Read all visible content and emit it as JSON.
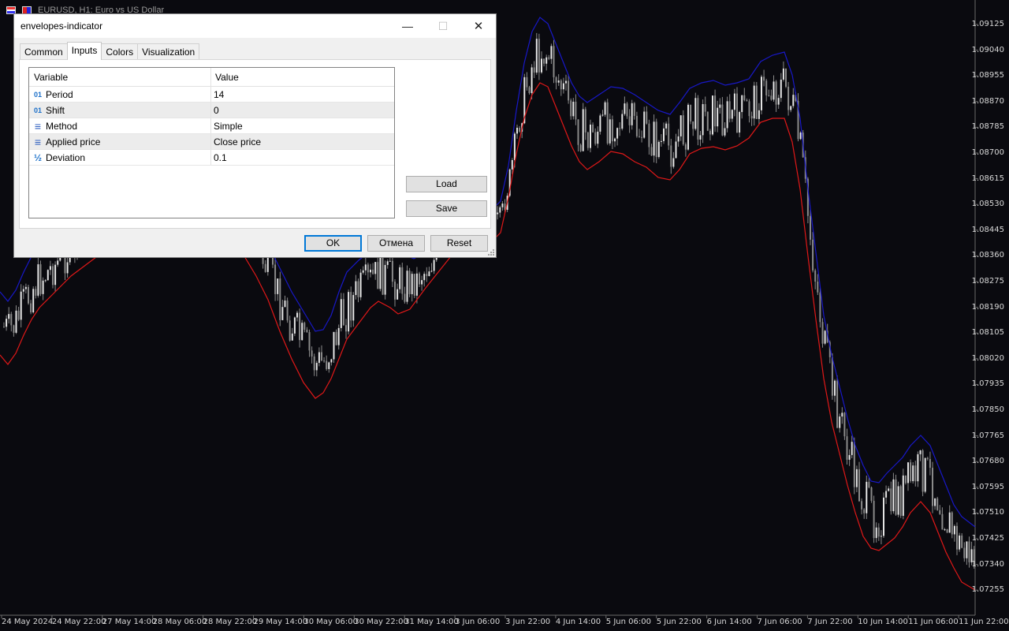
{
  "chart": {
    "title": "EURUSD, H1:  Euro vs US Dollar",
    "bull_color": "#ffffff",
    "upper_color": "#1818c8",
    "lower_color": "#e01818",
    "candle_color": "#8a8a8a",
    "price_labels": [
      "1.09125",
      "1.09040",
      "1.08955",
      "1.08870",
      "1.08785",
      "1.08700",
      "1.08615",
      "1.08530",
      "1.08445",
      "1.08360",
      "1.08275",
      "1.08190",
      "1.08105",
      "1.08020",
      "1.07935",
      "1.07850",
      "1.07765",
      "1.07680",
      "1.07595",
      "1.07510",
      "1.07425",
      "1.07340",
      "1.07255"
    ],
    "time_labels": [
      "24 May 2024",
      "24 May 22:00",
      "27 May 14:00",
      "28 May 06:00",
      "28 May 22:00",
      "29 May 14:00",
      "30 May 06:00",
      "30 May 22:00",
      "31 May 14:00",
      "3 Jun 06:00",
      "3 Jun 22:00",
      "4 Jun 14:00",
      "5 Jun 06:00",
      "5 Jun 22:00",
      "6 Jun 14:00",
      "7 Jun 06:00",
      "7 Jun 22:00",
      "10 Jun 14:00",
      "11 Jun 06:00",
      "11 Jun 22:00"
    ]
  },
  "dialog": {
    "title": "envelopes-indicator",
    "minimize": "—",
    "maximize": "☐",
    "close": "✕",
    "tabs": [
      "Common",
      "Inputs",
      "Colors",
      "Visualization"
    ],
    "columns": {
      "variable": "Variable",
      "value": "Value"
    },
    "rows": [
      {
        "icon": "01",
        "name": "Period",
        "value": "14"
      },
      {
        "icon": "01",
        "name": "Shift",
        "value": "0"
      },
      {
        "icon": "≡",
        "name": "Method",
        "value": "Simple"
      },
      {
        "icon": "≡",
        "name": "Applied price",
        "value": "Close price"
      },
      {
        "icon": "½",
        "name": "Deviation",
        "value": "0.1"
      }
    ],
    "load": "Load",
    "save": "Save",
    "ok": "OK",
    "cancel": "Отмена",
    "reset": "Reset"
  }
}
